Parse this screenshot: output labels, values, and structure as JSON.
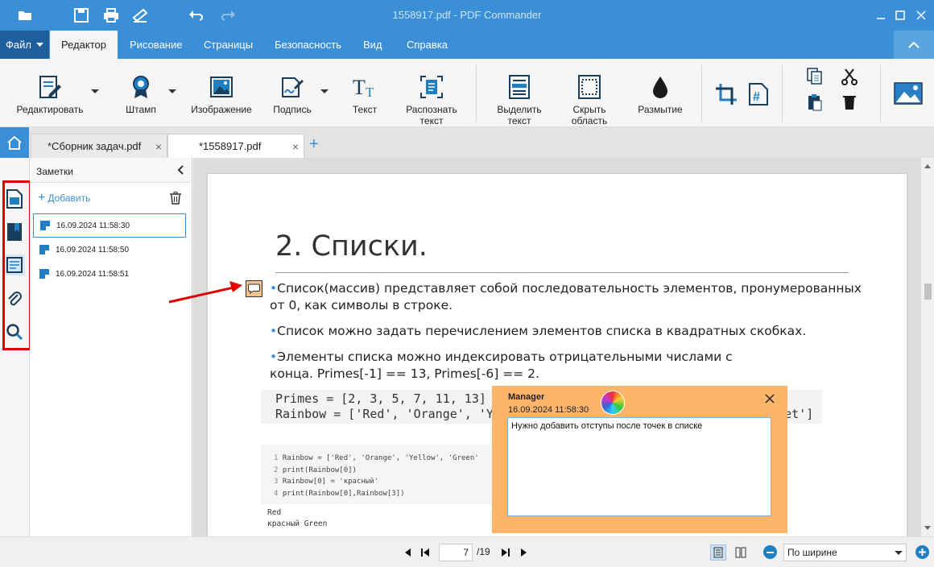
{
  "window": {
    "title": "1558917.pdf - PDF Commander"
  },
  "ribbon_tabs": {
    "file": "Файл",
    "items": [
      "Редактор",
      "Рисование",
      "Страницы",
      "Безопасность",
      "Вид",
      "Справка"
    ],
    "active": "Редактор"
  },
  "ribbon": {
    "edit": "Редактировать",
    "stamp": "Штамп",
    "image": "Изображение",
    "sign": "Подпись",
    "text": "Текст",
    "recognize": "Распознать\nтекст",
    "select_text": "Выделить\nтекст",
    "hide_area": "Скрыть\nобласть",
    "blur": "Размытие"
  },
  "doc_tabs": [
    {
      "label": "*Сборник задач.pdf",
      "active": false
    },
    {
      "label": "*1558917.pdf",
      "active": true
    }
  ],
  "notes_panel": {
    "title": "Заметки",
    "add": "Добавить",
    "items": [
      "16.09.2024 11:58:30",
      "16.09.2024 11:58:50",
      "16.09.2024 11:58:51"
    ]
  },
  "page": {
    "heading": "2. Списки.",
    "bullets": [
      "Список(массив) представляет собой последовательность элементов, пронумерованных от 0, как символы в строке.",
      "Список можно задать перечислением элементов списка в квадратных скобках.",
      "Элементы списка можно индексировать отрицательными числами с конца. Primes[-1] == 13, Primes[-6] == 2."
    ],
    "code_big": [
      "Primes = [2, 3, 5, 7, 11, 13]",
      "Rainbow = ['Red', 'Orange', 'Yellow', 'Green', 'Blue', 'Indigo', 'Violet']"
    ],
    "code_small": [
      "Rainbow = ['Red', 'Orange', 'Yellow', 'Green'",
      "print(Rainbow[0])",
      "Rainbow[0] = 'красный'",
      "print(Rainbow[0],Rainbow[3])"
    ],
    "output": [
      "Red",
      "красный Green"
    ]
  },
  "popup_note": {
    "author": "Manager",
    "date": "16.09.2024 11:58:30",
    "text": "Нужно добавить отступы после точек в списке"
  },
  "status": {
    "page": "7",
    "total": "/19",
    "zoom": "По ширине"
  },
  "colors": {
    "accent": "#3a8fd6",
    "note": "#fdb46b",
    "highlight_box": "#e30000"
  }
}
